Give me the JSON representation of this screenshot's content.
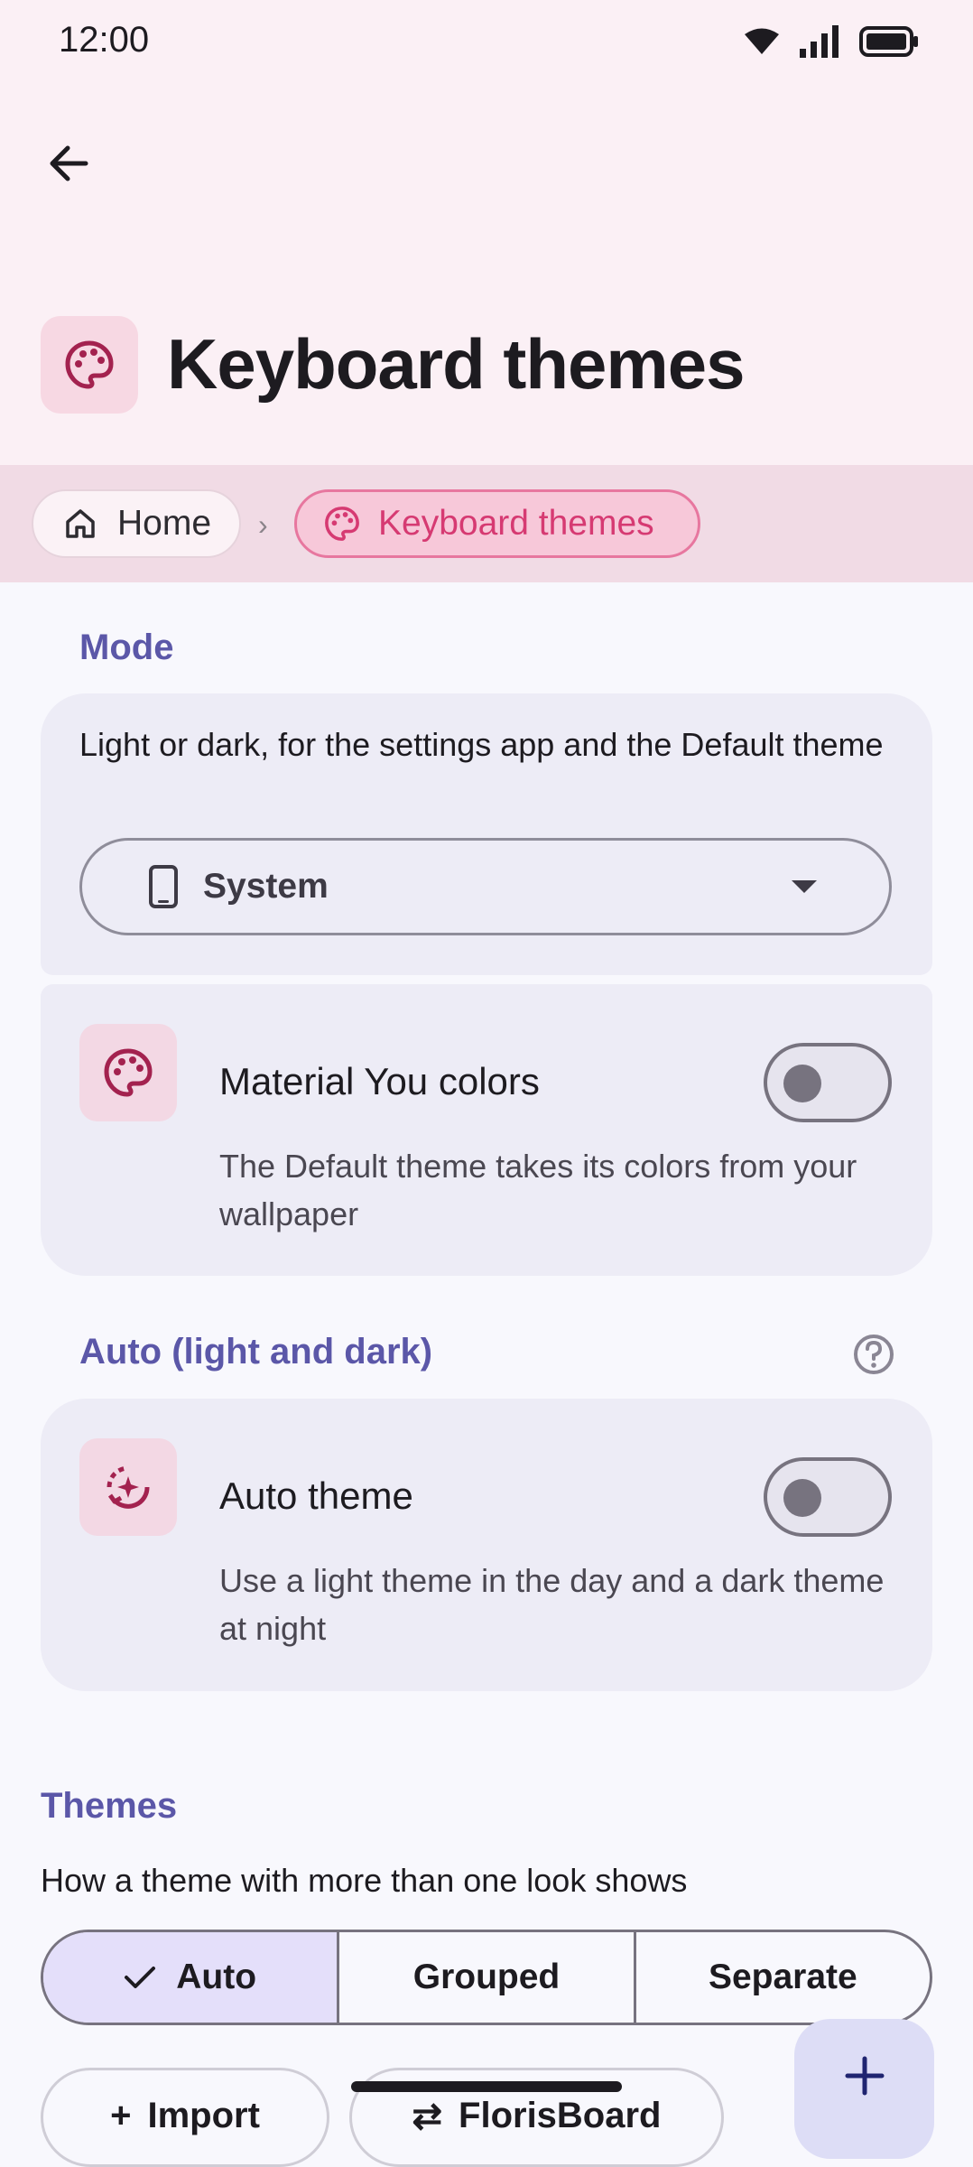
{
  "status_bar": {
    "time": "12:00"
  },
  "header": {
    "title": "Keyboard themes"
  },
  "breadcrumb": {
    "home": "Home",
    "separator": "›",
    "current": "Keyboard themes"
  },
  "mode": {
    "section_label": "Mode",
    "description": "Light or dark, for the settings app and the Default theme",
    "select_value": "System"
  },
  "material_you": {
    "title": "Material You colors",
    "description": "The Default theme takes its colors from your wallpaper",
    "enabled": false
  },
  "auto": {
    "section_label": "Auto (light and dark)",
    "title": "Auto theme",
    "description": "Use a light theme in the day and a dark theme at night",
    "enabled": false
  },
  "themes": {
    "section_label": "Themes",
    "description": "How a theme with more than one look shows",
    "segments": [
      "Auto",
      "Grouped",
      "Separate"
    ],
    "selected_segment": "Auto",
    "import_label": "Import",
    "florisboard_label": "FlorisBoard"
  },
  "colors": {
    "accent_pink": "#d63a72",
    "section_purple": "#5b57a8",
    "card_bg": "#edecf6"
  }
}
